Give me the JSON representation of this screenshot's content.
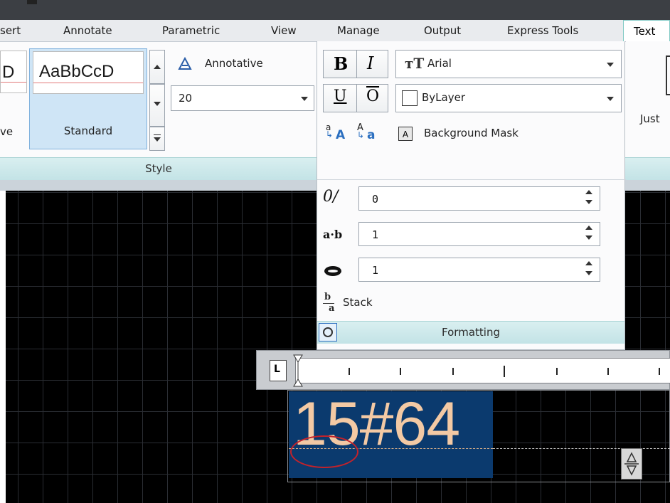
{
  "tabs": [
    {
      "label": "sert",
      "active": false
    },
    {
      "label": "Annotate",
      "active": false
    },
    {
      "label": "Parametric",
      "active": false
    },
    {
      "label": "View",
      "active": false
    },
    {
      "label": "Manage",
      "active": false
    },
    {
      "label": "Output",
      "active": false
    },
    {
      "label": "Express Tools",
      "active": false
    },
    {
      "label": "Text",
      "active": true
    }
  ],
  "style_panel": {
    "prev_sample": "D",
    "prev_label": "ve",
    "current_sample": "AaBbCcD",
    "current_label": "Standard",
    "annotative_label": "Annotative",
    "text_height": "20",
    "footer": "Style"
  },
  "formatting": {
    "bold": "B",
    "italic": "I",
    "underline": "U",
    "overline": "O",
    "font": "Arial",
    "color": "ByLayer",
    "case_upper": "A",
    "case_lower": "a",
    "background_mask": "Background Mask",
    "oblique_angle": "0",
    "tracking": "1",
    "width_factor": "1",
    "stack": "Stack",
    "footer": "Formatting"
  },
  "right_panel": {
    "label": "Just"
  },
  "ruler": {
    "tab_type": "L"
  },
  "editor": {
    "text": "15#64"
  },
  "colors": {
    "accent_teal": "#7fc9c4",
    "selection": "#0b3a6e",
    "text_fill": "#f3c9a4",
    "annotation_circle": "#c4222a"
  }
}
